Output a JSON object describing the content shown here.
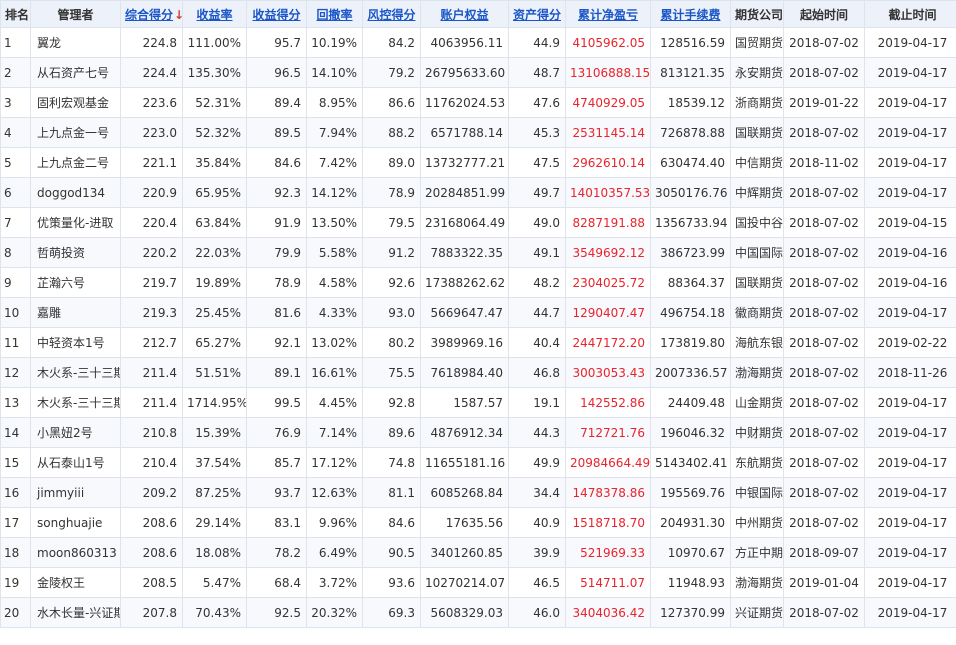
{
  "headers": [
    "排名",
    "管理者",
    "综合得分",
    "收益率",
    "收益得分",
    "回撤率",
    "风控得分",
    "账户权益",
    "资产得分",
    "累计净盈亏",
    "累计手续费",
    "期货公司",
    "起始时间",
    "截止时间"
  ],
  "sort_arrow": "↓",
  "rows": [
    [
      "1",
      "翼龙",
      "224.8",
      "111.00%",
      "95.7",
      "10.19%",
      "84.2",
      "4063956.11",
      "44.9",
      "4105962.05",
      "128516.59",
      "国贸期货",
      "2018-07-02",
      "2019-04-17"
    ],
    [
      "2",
      "从石资产七号",
      "224.4",
      "135.30%",
      "96.5",
      "14.10%",
      "79.2",
      "26795633.60",
      "48.7",
      "13106888.15",
      "813121.35",
      "永安期货",
      "2018-07-02",
      "2019-04-17"
    ],
    [
      "3",
      "固利宏观基金",
      "223.6",
      "52.31%",
      "89.4",
      "8.95%",
      "86.6",
      "11762024.53",
      "47.6",
      "4740929.05",
      "18539.12",
      "浙商期货",
      "2019-01-22",
      "2019-04-17"
    ],
    [
      "4",
      "上九点金一号",
      "223.0",
      "52.32%",
      "89.5",
      "7.94%",
      "88.2",
      "6571788.14",
      "45.3",
      "2531145.14",
      "726878.88",
      "国联期货",
      "2018-07-02",
      "2019-04-17"
    ],
    [
      "5",
      "上九点金二号",
      "221.1",
      "35.84%",
      "84.6",
      "7.42%",
      "89.0",
      "13732777.21",
      "47.5",
      "2962610.14",
      "630474.40",
      "中信期货",
      "2018-11-02",
      "2019-04-17"
    ],
    [
      "6",
      "doggod134",
      "220.9",
      "65.95%",
      "92.3",
      "14.12%",
      "78.9",
      "20284851.99",
      "49.7",
      "14010357.53",
      "3050176.76",
      "中辉期货",
      "2018-07-02",
      "2019-04-17"
    ],
    [
      "7",
      "优策量化-进取",
      "220.4",
      "63.84%",
      "91.9",
      "13.50%",
      "79.5",
      "23168064.49",
      "49.0",
      "8287191.88",
      "1356733.94",
      "国投中谷",
      "2018-07-02",
      "2019-04-15"
    ],
    [
      "8",
      "哲萌投资",
      "220.2",
      "22.03%",
      "79.9",
      "5.58%",
      "91.2",
      "7883322.35",
      "49.1",
      "3549692.12",
      "386723.99",
      "中国国际",
      "2018-07-02",
      "2019-04-16"
    ],
    [
      "9",
      "芷瀚六号",
      "219.7",
      "19.89%",
      "78.9",
      "4.58%",
      "92.6",
      "17388262.62",
      "48.2",
      "2304025.72",
      "88364.37",
      "国联期货",
      "2018-07-02",
      "2019-04-16"
    ],
    [
      "10",
      "嘉雕",
      "219.3",
      "25.45%",
      "81.6",
      "4.33%",
      "93.0",
      "5669647.47",
      "44.7",
      "1290407.47",
      "496754.18",
      "徽商期货",
      "2018-07-02",
      "2019-04-17"
    ],
    [
      "11",
      "中轻资本1号",
      "212.7",
      "65.27%",
      "92.1",
      "13.02%",
      "80.2",
      "3989969.16",
      "40.4",
      "2447172.20",
      "173819.80",
      "海航东银",
      "2018-07-02",
      "2019-02-22"
    ],
    [
      "12",
      "木火系-三十三期",
      "211.4",
      "51.51%",
      "89.1",
      "16.61%",
      "75.5",
      "7618984.40",
      "46.8",
      "3003053.43",
      "2007336.57",
      "渤海期货",
      "2018-07-02",
      "2018-11-26"
    ],
    [
      "13",
      "木火系-三十三期",
      "211.4",
      "1714.95%",
      "99.5",
      "4.45%",
      "92.8",
      "1587.57",
      "19.1",
      "142552.86",
      "24409.48",
      "山金期货",
      "2018-07-02",
      "2019-04-17"
    ],
    [
      "14",
      "小黑妞2号",
      "210.8",
      "15.39%",
      "76.9",
      "7.14%",
      "89.6",
      "4876912.34",
      "44.3",
      "712721.76",
      "196046.32",
      "中财期货",
      "2018-07-02",
      "2019-04-17"
    ],
    [
      "15",
      "从石泰山1号",
      "210.4",
      "37.54%",
      "85.7",
      "17.12%",
      "74.8",
      "11655181.16",
      "49.9",
      "20984664.49",
      "5143402.41",
      "东航期货",
      "2018-07-02",
      "2019-04-17"
    ],
    [
      "16",
      "jimmyiii",
      "209.2",
      "87.25%",
      "93.7",
      "12.63%",
      "81.1",
      "6085268.84",
      "34.4",
      "1478378.86",
      "195569.76",
      "中银国际",
      "2018-07-02",
      "2019-04-17"
    ],
    [
      "17",
      "songhuajie",
      "208.6",
      "29.14%",
      "83.1",
      "9.96%",
      "84.6",
      "17635.56",
      "40.9",
      "1518718.70",
      "204931.30",
      "中州期货",
      "2018-07-02",
      "2019-04-17"
    ],
    [
      "18",
      "moon860313",
      "208.6",
      "18.08%",
      "78.2",
      "6.49%",
      "90.5",
      "3401260.85",
      "39.9",
      "521969.33",
      "10970.67",
      "方正中期",
      "2018-09-07",
      "2019-04-17"
    ],
    [
      "19",
      "金陵权王",
      "208.5",
      "5.47%",
      "68.4",
      "3.72%",
      "93.6",
      "10270214.07",
      "46.5",
      "514711.07",
      "11948.93",
      "渤海期货",
      "2019-01-04",
      "2019-04-17"
    ],
    [
      "20",
      "水木长量-兴证期货",
      "207.8",
      "70.43%",
      "92.5",
      "20.32%",
      "69.3",
      "5608329.03",
      "46.0",
      "3404036.42",
      "127370.99",
      "兴证期货",
      "2018-07-02",
      "2019-04-17"
    ]
  ]
}
